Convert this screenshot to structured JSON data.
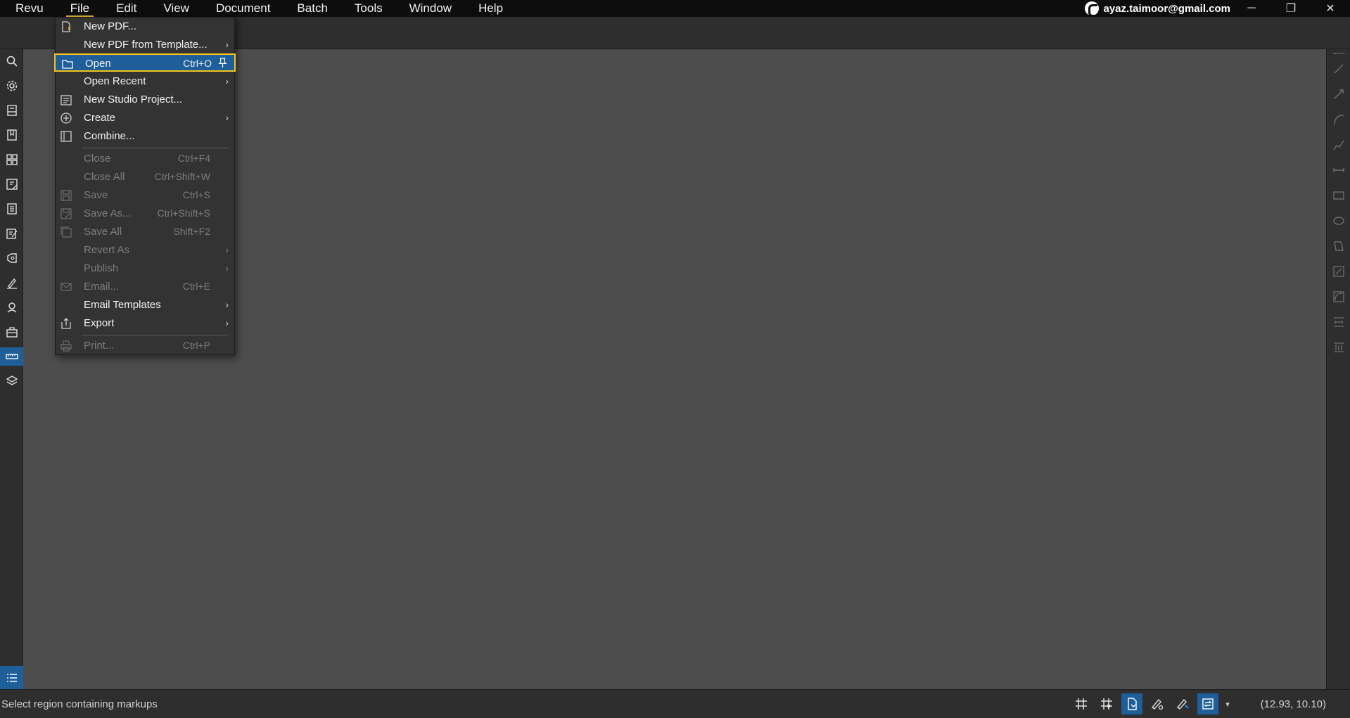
{
  "menubar": {
    "items": [
      "Revu",
      "File",
      "Edit",
      "View",
      "Document",
      "Batch",
      "Tools",
      "Window",
      "Help"
    ],
    "active_index": 1
  },
  "account": {
    "email": "ayaz.taimoor@gmail.com"
  },
  "window_controls": {
    "minimize": "─",
    "restore": "❐",
    "close": "✕"
  },
  "file_menu": {
    "items": [
      {
        "label": "New PDF...",
        "shortcut": "",
        "submenu": false,
        "disabled": false,
        "icon": "new-pdf-icon"
      },
      {
        "label": "New PDF from Template...",
        "shortcut": "",
        "submenu": true,
        "disabled": false,
        "icon": ""
      },
      {
        "label": "Open",
        "shortcut": "Ctrl+O",
        "submenu": false,
        "disabled": false,
        "icon": "folder-icon",
        "highlighted": true,
        "pinnable": true
      },
      {
        "label": "Open Recent",
        "shortcut": "",
        "submenu": true,
        "disabled": false,
        "icon": ""
      },
      {
        "label": "New Studio Project...",
        "shortcut": "",
        "submenu": false,
        "disabled": false,
        "icon": "studio-project-icon"
      },
      {
        "label": "Create",
        "shortcut": "",
        "submenu": true,
        "disabled": false,
        "icon": "plus-circle-icon"
      },
      {
        "label": "Combine...",
        "shortcut": "",
        "submenu": false,
        "disabled": false,
        "icon": "combine-icon"
      },
      {
        "label": "Close",
        "shortcut": "Ctrl+F4",
        "submenu": false,
        "disabled": true,
        "icon": ""
      },
      {
        "label": "Close All",
        "shortcut": "Ctrl+Shift+W",
        "submenu": false,
        "disabled": true,
        "icon": ""
      },
      {
        "label": "Save",
        "shortcut": "Ctrl+S",
        "submenu": false,
        "disabled": true,
        "icon": "save-icon"
      },
      {
        "label": "Save As...",
        "shortcut": "Ctrl+Shift+S",
        "submenu": false,
        "disabled": true,
        "icon": "save-as-icon"
      },
      {
        "label": "Save All",
        "shortcut": "Shift+F2",
        "submenu": false,
        "disabled": true,
        "icon": "save-all-icon"
      },
      {
        "label": "Revert As",
        "shortcut": "",
        "submenu": true,
        "disabled": true,
        "icon": ""
      },
      {
        "label": "Publish",
        "shortcut": "",
        "submenu": true,
        "disabled": true,
        "icon": ""
      },
      {
        "label": "Email...",
        "shortcut": "Ctrl+E",
        "submenu": false,
        "disabled": true,
        "icon": "email-icon"
      },
      {
        "label": "Email Templates",
        "shortcut": "",
        "submenu": true,
        "disabled": false,
        "icon": ""
      },
      {
        "label": "Export",
        "shortcut": "",
        "submenu": true,
        "disabled": false,
        "icon": "export-icon"
      },
      {
        "label": "Print...",
        "shortcut": "Ctrl+P",
        "submenu": false,
        "disabled": true,
        "icon": "print-icon"
      }
    ]
  },
  "statusbar": {
    "text": "Select region containing markups",
    "coords": "(12.93, 10.10)"
  },
  "colors": {
    "accent": "#1e5f9a",
    "highlight_border": "#f2c318",
    "menubar_bg": "#0d0d0d",
    "panel_bg": "#2e2e2e",
    "workspace_bg": "#4d4d4d"
  }
}
